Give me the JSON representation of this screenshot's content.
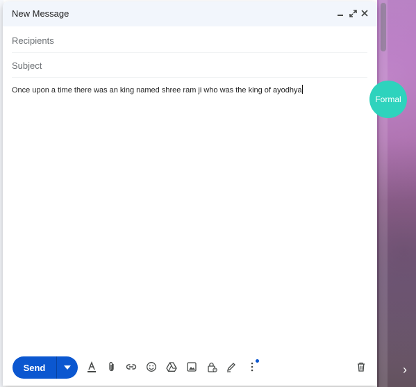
{
  "window": {
    "title": "New Message",
    "controls": [
      "minimize-icon",
      "expand-icon",
      "close-icon"
    ]
  },
  "fields": {
    "recipients_placeholder": "Recipients",
    "subject_placeholder": "Subject"
  },
  "body": {
    "text": "Once upon a time there was an king named shree ram ji who was the king of ayodhya"
  },
  "tone_bubble": {
    "label": "Formal",
    "color": "#2ed3bd"
  },
  "toolbar": {
    "send_label": "Send",
    "send_color": "#0b57d0",
    "tools": [
      "formatting-options-icon",
      "attach-file-icon",
      "insert-link-icon",
      "insert-emoji-icon",
      "google-drive-icon",
      "insert-photo-icon",
      "confidential-mode-icon",
      "insert-signature-icon",
      "more-options-icon",
      "discard-draft-icon"
    ]
  }
}
